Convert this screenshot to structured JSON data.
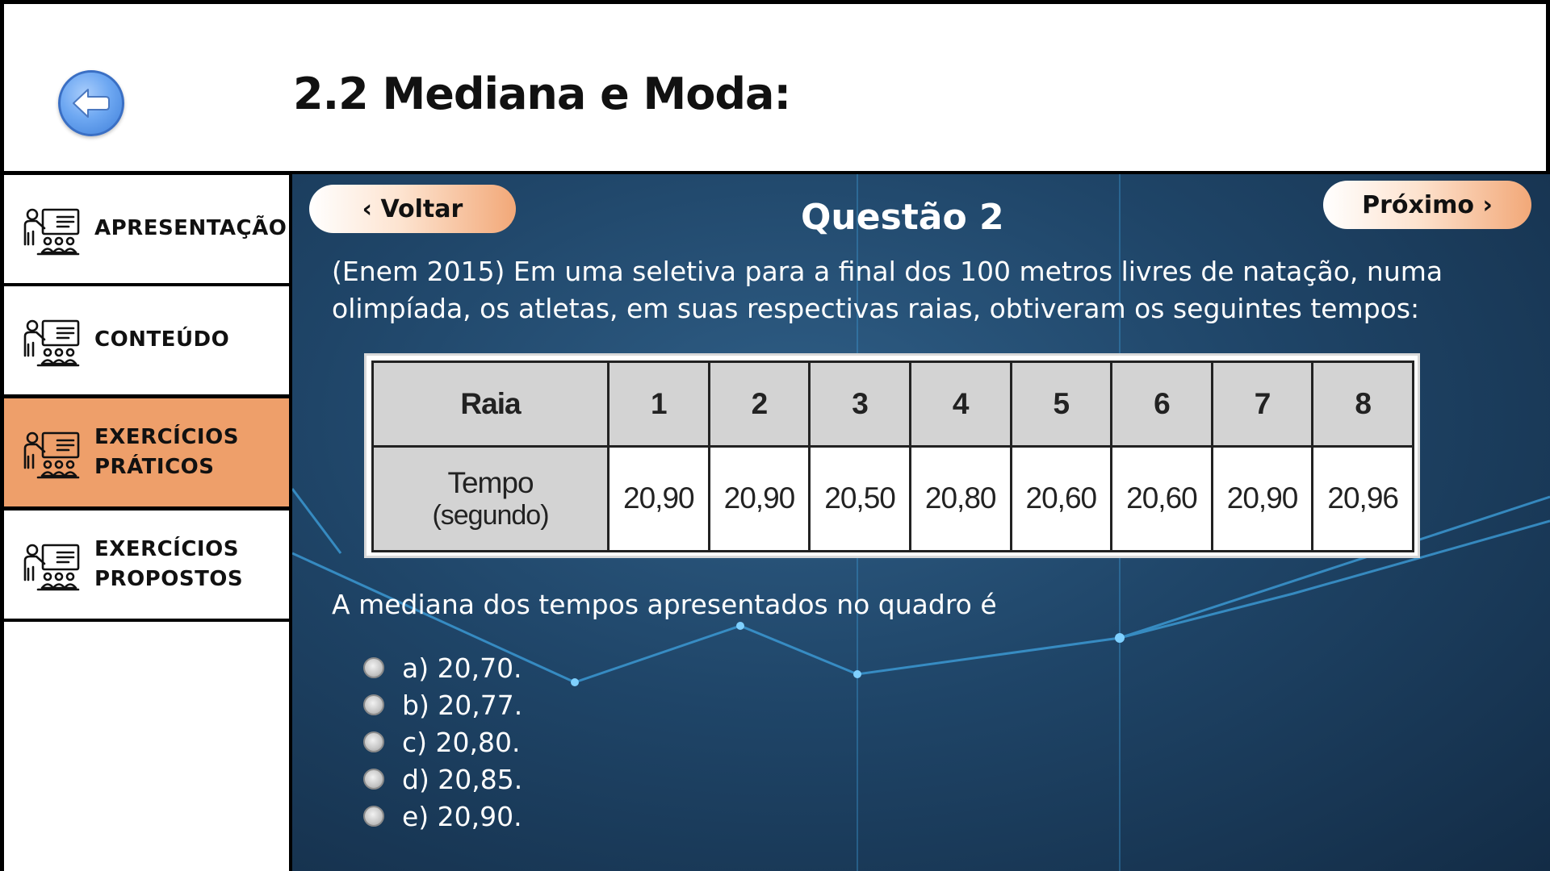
{
  "header": {
    "title": "2.2 Mediana e Moda:",
    "back_icon": "arrow-left-circle-icon"
  },
  "sidebar": {
    "items": [
      {
        "line1": "APRESENTAÇÃO",
        "line2": "",
        "icon": "teacher-presentation-icon",
        "active": false
      },
      {
        "line1": "CONTEÚDO",
        "line2": "",
        "icon": "teacher-presentation-icon",
        "active": false
      },
      {
        "line1": "EXERCÍCIOS",
        "line2": "PRÁTICOS",
        "icon": "teacher-presentation-icon",
        "active": true
      },
      {
        "line1": "EXERCÍCIOS",
        "line2": "PROPOSTOS",
        "icon": "teacher-presentation-icon",
        "active": false
      }
    ],
    "active_color": "#ee9f6a"
  },
  "main": {
    "prev_label": "‹ Voltar",
    "next_label": "Próximo ›",
    "question_title": "Questão 2",
    "question_text": "(Enem 2015) Em uma seletiva para a final dos 100 metros livres de natação, numa olimpíada, os atletas, em suas respectivas raias, obtiveram os seguintes tempos:",
    "table": {
      "header_label": "Raia",
      "lanes": [
        "1",
        "2",
        "3",
        "4",
        "5",
        "6",
        "7",
        "8"
      ],
      "row_label": "Tempo",
      "row_sublabel": "(segundo)",
      "times": [
        "20,90",
        "20,90",
        "20,50",
        "20,80",
        "20,60",
        "20,60",
        "20,90",
        "20,96"
      ]
    },
    "prompt": "A mediana dos tempos apresentados no quadro é",
    "options": [
      "a) 20,70.",
      "b) 20,77.",
      "c) 20,80.",
      "d) 20,85.",
      "e) 20,90."
    ]
  }
}
